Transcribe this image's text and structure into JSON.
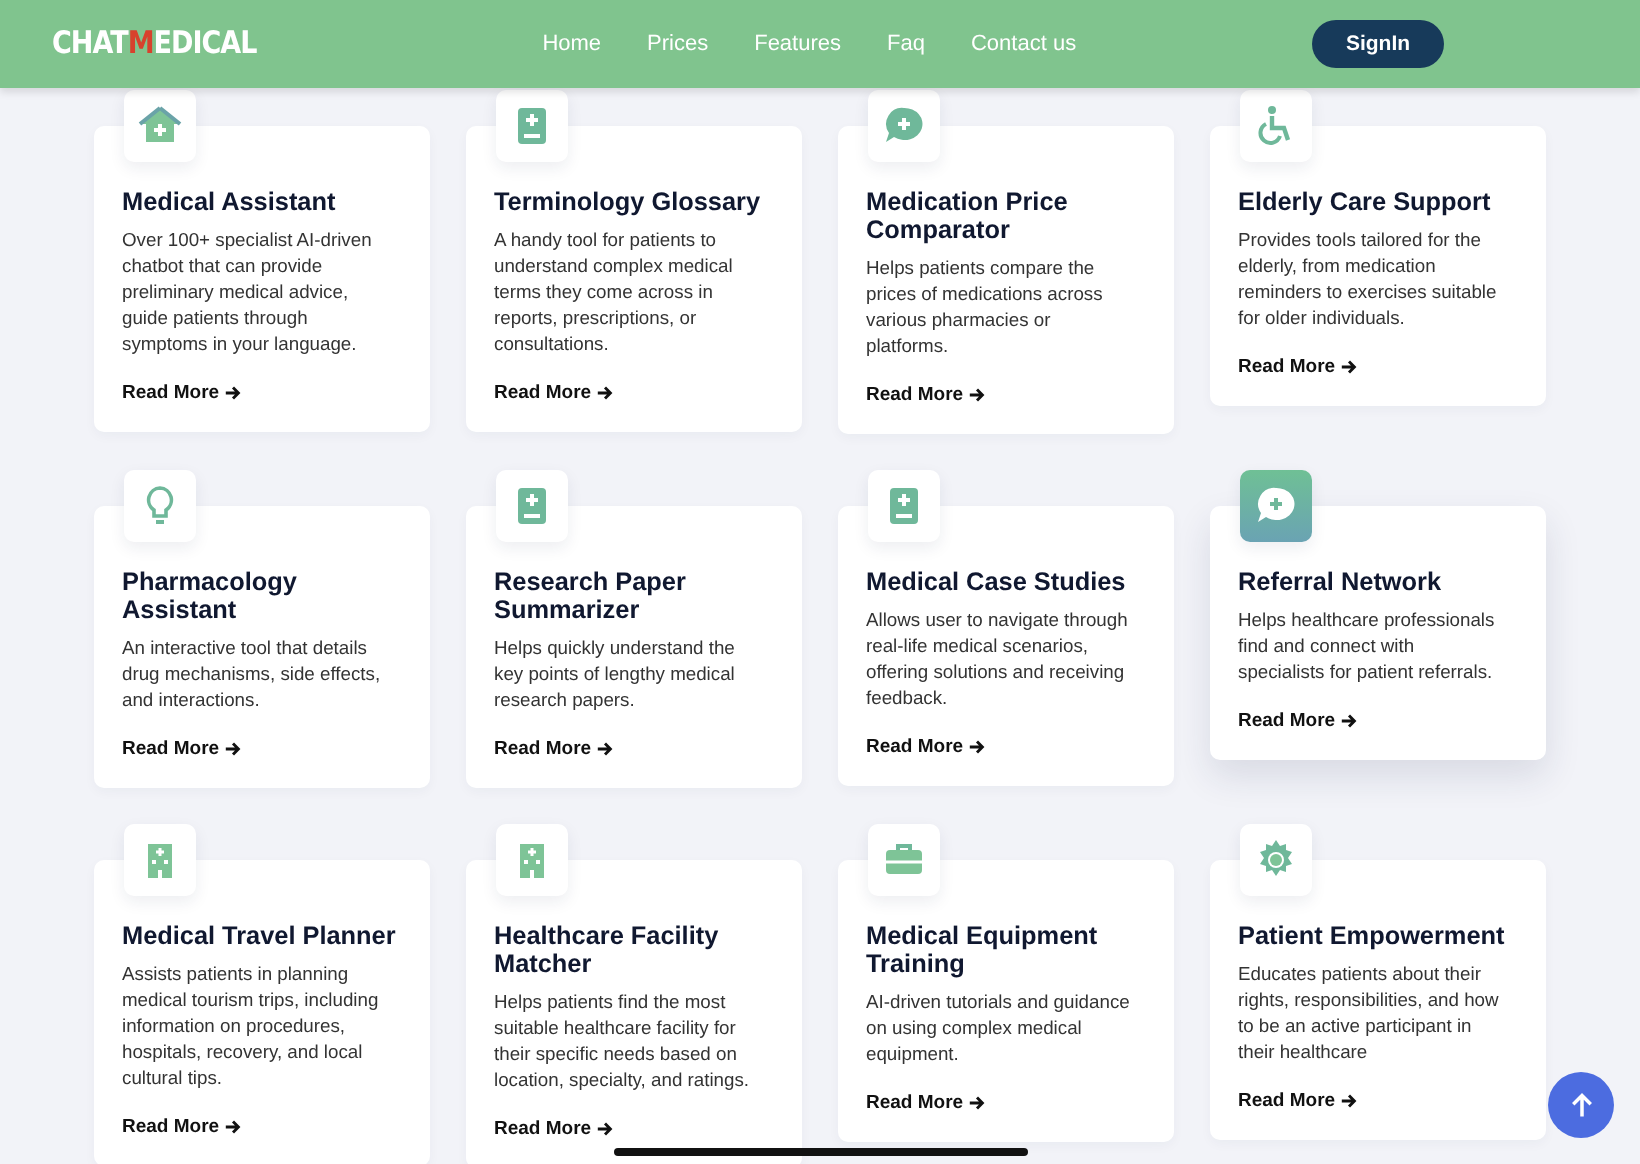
{
  "logo": [
    {
      "text": "CHAT",
      "accent": false
    },
    {
      "text": "M",
      "accent": true
    },
    {
      "text": "EDICAL",
      "accent": false
    }
  ],
  "nav": [
    "Home",
    "Prices",
    "Features",
    "Faq",
    "Contact us"
  ],
  "signin": "SignIn",
  "cards": [
    {
      "title": "Medical Assistant",
      "text": "Over 100+ specialist AI-driven chatbot that can provide preliminary medical advice, guide patients through symptoms in your language.",
      "link": "Read More",
      "highlighted": false
    },
    {
      "title": "Terminology Glossary",
      "text": "A handy tool for patients to understand complex medical terms they come across in reports, prescriptions, or consultations.",
      "link": "Read More",
      "highlighted": false
    },
    {
      "title": "Medication Price Comparator",
      "text": "Helps patients compare the prices of medications across various pharmacies or platforms.",
      "link": "Read More",
      "highlighted": false
    },
    {
      "title": "Elderly Care Support",
      "text": "Provides tools tailored for the elderly, from medication reminders to exercises suitable for older individuals.",
      "link": "Read More",
      "highlighted": false
    },
    {
      "title": "Pharmacology Assistant",
      "text": "An interactive tool that details drug mechanisms, side effects, and interactions.",
      "link": "Read More",
      "highlighted": false
    },
    {
      "title": "Research Paper Summarizer",
      "text": "Helps quickly understand the key points of lengthy medical research papers.",
      "link": "Read More",
      "highlighted": false
    },
    {
      "title": "Medical Case Studies",
      "text": "Allows user to navigate through real-life medical scenarios, offering solutions and receiving feedback.",
      "link": "Read More",
      "highlighted": false
    },
    {
      "title": "Referral Network",
      "text": "Helps healthcare professionals find and connect with specialists for patient referrals.",
      "link": "Read More",
      "highlighted": true
    },
    {
      "title": "Medical Travel Planner",
      "text": "Assists patients in planning medical tourism trips, including information on procedures, hospitals, recovery, and local cultural tips.",
      "link": "Read More",
      "highlighted": false
    },
    {
      "title": "Healthcare Facility Matcher",
      "text": "Helps patients find the most suitable healthcare facility for their specific needs based on location, specialty, and ratings.",
      "link": "Read More",
      "highlighted": false
    },
    {
      "title": "Medical Equipment Training",
      "text": "AI-driven tutorials and guidance on using complex medical equipment.",
      "link": "Read More",
      "highlighted": false
    },
    {
      "title": "Patient Empowerment",
      "text": "Educates patients about their rights, responsibilities, and how to be an active participant in their healthcare",
      "link": "Read More",
      "highlighted": false
    }
  ]
}
